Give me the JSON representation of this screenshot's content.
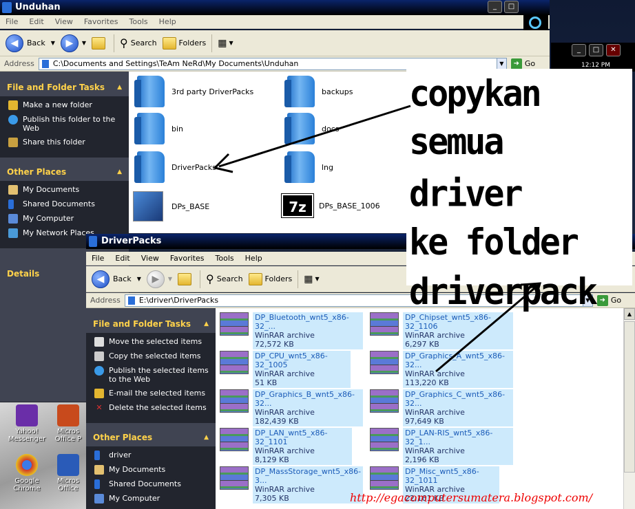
{
  "desktop": {
    "icons": [
      {
        "label": "Yahoo! Messenger",
        "icon": "yahoo-messenger-icon",
        "color": "#6a2ea8"
      },
      {
        "label": "Micros Office P",
        "icon": "office-powerpoint-icon",
        "color": "#c84a1c"
      },
      {
        "label": "Google Chrome",
        "icon": "chrome-icon",
        "color": "#d0382a"
      },
      {
        "label": "Micros Office",
        "icon": "office-word-icon",
        "color": "#2a5bb8"
      }
    ],
    "clock": "12:12 PM"
  },
  "window_back": {
    "title": "Unduhan",
    "menu": [
      "File",
      "Edit",
      "View",
      "Favorites",
      "Tools",
      "Help"
    ],
    "toolbar": {
      "back": "Back",
      "search": "Search",
      "folders": "Folders"
    },
    "address": {
      "label": "Address",
      "value": "C:\\Documents and Settings\\TeAm NeRd\\My Documents\\Unduhan",
      "go": "Go"
    },
    "file_tasks": {
      "title": "File and Folder Tasks",
      "items": [
        "Make a new folder",
        "Publish this folder to the Web",
        "Share this folder"
      ]
    },
    "other_places": {
      "title": "Other Places",
      "items": [
        "My Documents",
        "Shared Documents",
        "My Computer",
        "My Network Places"
      ]
    },
    "details": {
      "title": "Details"
    },
    "files": [
      {
        "name": "3rd party DriverPacks",
        "kind": "folder"
      },
      {
        "name": "backups",
        "kind": "folder"
      },
      {
        "name": "bin",
        "kind": "folder"
      },
      {
        "name": "docs",
        "kind": "folder"
      },
      {
        "name": "DriverPacks",
        "kind": "folder"
      },
      {
        "name": "lng",
        "kind": "folder"
      },
      {
        "name": "DPs_BASE",
        "kind": "app"
      },
      {
        "name": "DPs_BASE_1006",
        "kind": "7z"
      }
    ]
  },
  "window_front": {
    "title": "DriverPacks",
    "menu": [
      "File",
      "Edit",
      "View",
      "Favorites",
      "Tools",
      "Help"
    ],
    "toolbar": {
      "back": "Back",
      "search": "Search",
      "folders": "Folders"
    },
    "address": {
      "label": "Address",
      "value": "E:\\driver\\DriverPacks",
      "go": "Go"
    },
    "file_tasks": {
      "title": "File and Folder Tasks",
      "items": [
        "Move the selected items",
        "Copy the selected items",
        "Publish the selected items to the Web",
        "E-mail the selected items",
        "Delete the selected items"
      ]
    },
    "other_places": {
      "title": "Other Places",
      "items": [
        "driver",
        "My Documents",
        "Shared Documents",
        "My Computer"
      ]
    },
    "archives": [
      {
        "name": "DP_Bluetooth_wnt5_x86-32_...",
        "type": "WinRAR archive",
        "size": "72,572 KB"
      },
      {
        "name": "DP_Chipset_wnt5_x86-32_1106",
        "type": "WinRAR archive",
        "size": "6,297 KB"
      },
      {
        "name": "DP_CPU_wnt5_x86-32_1005",
        "type": "WinRAR archive",
        "size": "51 KB"
      },
      {
        "name": "DP_Graphics_A_wnt5_x86-32...",
        "type": "WinRAR archive",
        "size": "113,220 KB"
      },
      {
        "name": "DP_Graphics_B_wnt5_x86-32...",
        "type": "WinRAR archive",
        "size": "182,439 KB"
      },
      {
        "name": "DP_Graphics_C_wnt5_x86-32...",
        "type": "WinRAR archive",
        "size": "97,649 KB"
      },
      {
        "name": "DP_LAN_wnt5_x86-32_1101",
        "type": "WinRAR archive",
        "size": "8,129 KB"
      },
      {
        "name": "DP_LAN-RIS_wnt5_x86-32_1...",
        "type": "WinRAR archive",
        "size": "2,196 KB"
      },
      {
        "name": "DP_MassStorage_wnt5_x86-3...",
        "type": "WinRAR archive",
        "size": "7,305 KB"
      },
      {
        "name": "DP_Misc_wnt5_x86-32_1011",
        "type": "WinRAR archive",
        "size": "22,161 KB"
      }
    ]
  },
  "annotation": {
    "lines": [
      "copykan",
      "semua driver",
      "ke folder",
      "driverpack"
    ]
  },
  "watermark": {
    "url": "http://egacomputersumatera.blogspot.com/",
    "color": "#ee0000"
  }
}
